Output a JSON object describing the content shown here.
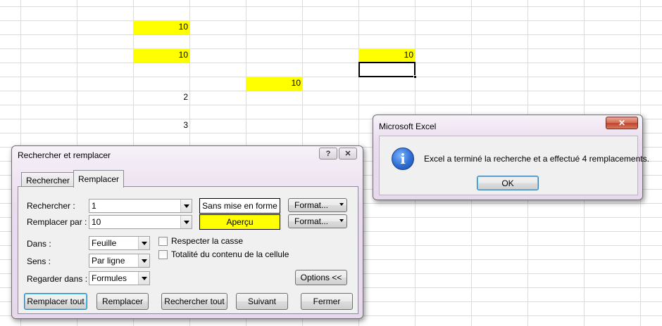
{
  "sheet": {
    "cells": [
      {
        "value": "10",
        "highlight": "#ffff00"
      },
      {
        "value": "10",
        "highlight": "#ffff00"
      },
      {
        "value": "10",
        "highlight": "#ffff00"
      },
      {
        "value": "10",
        "highlight": "#ffff00"
      },
      {
        "value": "2"
      },
      {
        "value": "3"
      }
    ]
  },
  "replace_dialog": {
    "title": "Rechercher et remplacer",
    "help_icon": "?",
    "close_icon": "✕",
    "tabs": [
      {
        "label": "Rechercher",
        "active": false
      },
      {
        "label": "Remplacer",
        "active": true
      }
    ],
    "find_label": "Rechercher :",
    "find_value": "1",
    "find_format": "Sans mise en forme",
    "replace_label": "Remplacer par :",
    "replace_value": "10",
    "replace_format": "Aperçu",
    "replace_format_color": "#ffff00",
    "format_button": "Format...",
    "within_label": "Dans :",
    "within_value": "Feuille",
    "search_label": "Sens :",
    "search_value": "Par ligne",
    "look_in_label": "Regarder dans :",
    "look_in_value": "Formules",
    "match_case_label": "Respecter la casse",
    "match_entire_label": "Totalité du contenu de la cellule",
    "options_button": "Options <<",
    "buttons": {
      "replace_all": "Remplacer tout",
      "replace": "Remplacer",
      "find_all": "Rechercher tout",
      "find_next": "Suivant",
      "close": "Fermer"
    }
  },
  "message_box": {
    "title": "Microsoft Excel",
    "close_icon": "✕",
    "icon": "information-icon",
    "message": "Excel a terminé la recherche et a effectué 4 remplacements.",
    "ok": "OK"
  }
}
